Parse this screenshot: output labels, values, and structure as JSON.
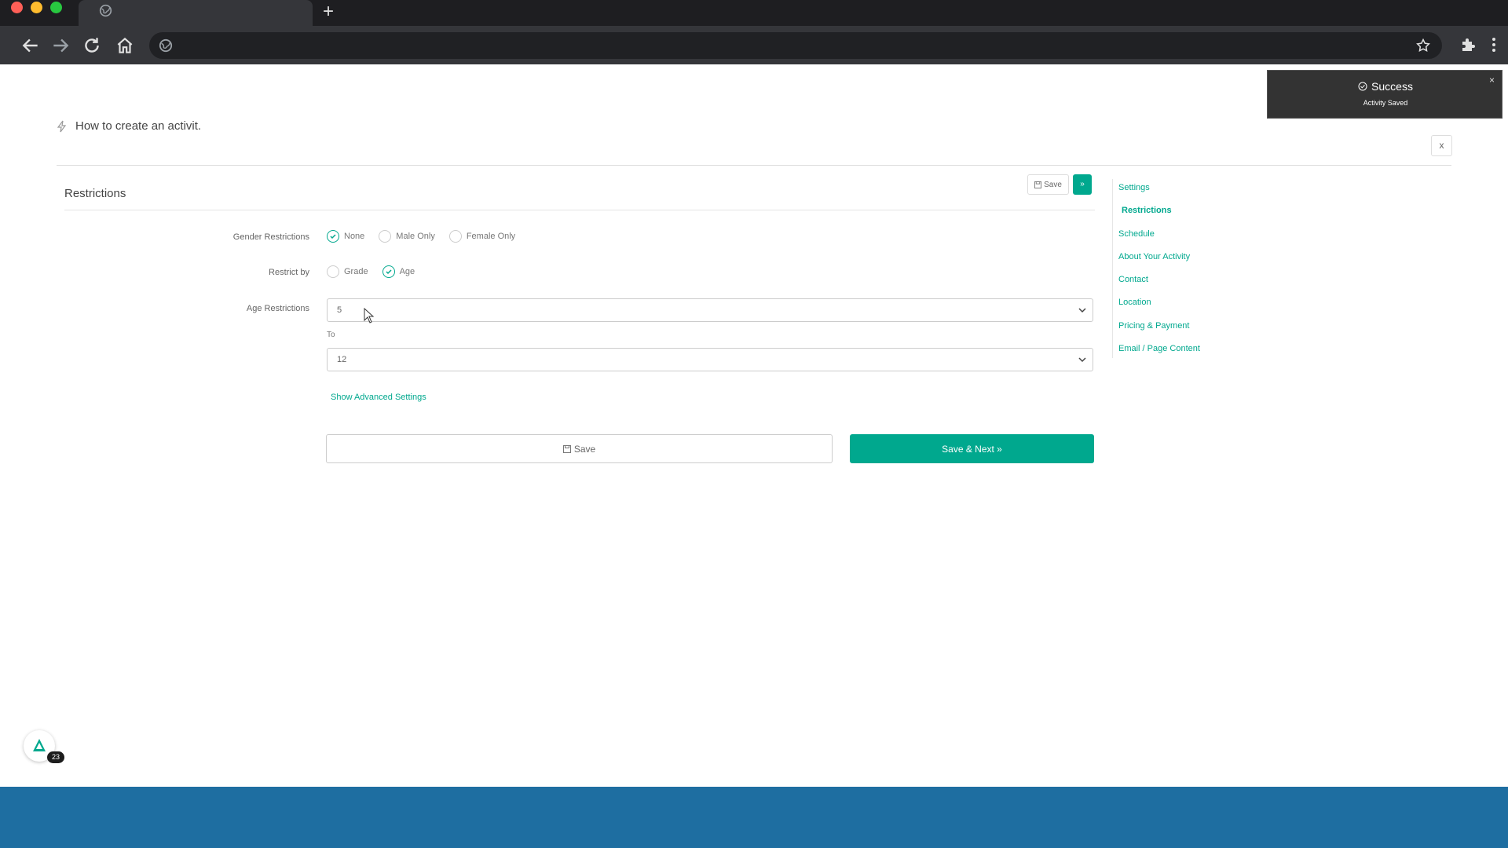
{
  "browser": {
    "new_tab_label": "+"
  },
  "page": {
    "title": "How to create an activit.",
    "close_label": "x"
  },
  "section": {
    "title": "Restrictions",
    "top_save_label": "Save",
    "top_next_label": "»"
  },
  "form": {
    "gender": {
      "label": "Gender Restrictions",
      "options": [
        "None",
        "Male Only",
        "Female Only"
      ],
      "selected": "None"
    },
    "restrict_by": {
      "label": "Restrict by",
      "options": [
        "Grade",
        "Age"
      ],
      "selected": "Age"
    },
    "age": {
      "label": "Age Restrictions",
      "from_value": "5",
      "to_label": "To",
      "to_value": "12"
    },
    "advanced_link": "Show Advanced Settings",
    "save_label": "Save",
    "save_next_label": "Save & Next »"
  },
  "side_nav": {
    "items": [
      "Settings",
      "Restrictions",
      "Schedule",
      "About Your Activity",
      "Contact",
      "Location",
      "Pricing & Payment",
      "Email / Page Content"
    ],
    "active": "Restrictions"
  },
  "toast": {
    "title": "Success",
    "message": "Activity Saved",
    "close_label": "×"
  },
  "widget": {
    "badge_count": "23"
  },
  "colors": {
    "accent": "#00a88e",
    "toast_bg": "#333333",
    "footer_band": "#1e6ea1"
  }
}
